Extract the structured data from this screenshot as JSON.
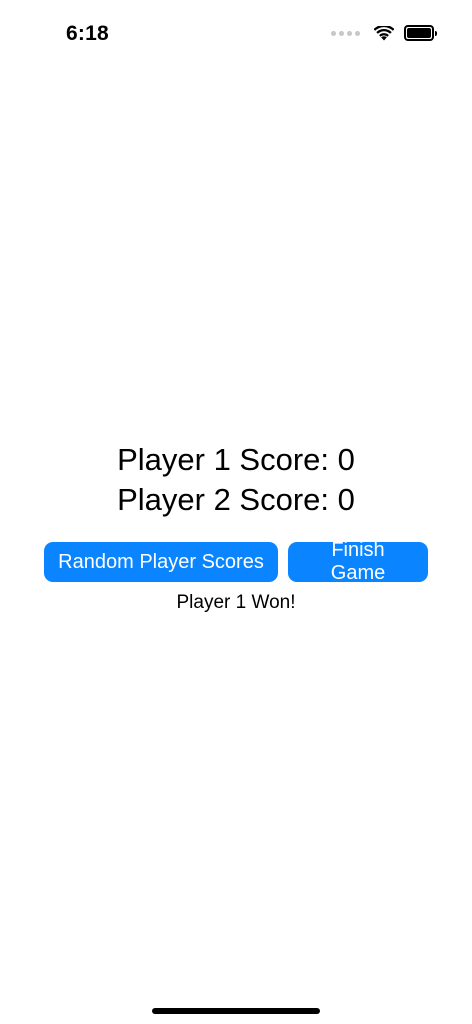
{
  "status_bar": {
    "time": "6:18",
    "icons": [
      "cellular-dots-icon",
      "wifi-icon",
      "battery-icon"
    ]
  },
  "scores": {
    "player1": "Player 1 Score: 0",
    "player2": "Player 2 Score: 0"
  },
  "buttons": {
    "random_label": "Random Player Scores",
    "finish_label": "Finish Game"
  },
  "result_text": "Player 1 Won!",
  "colors": {
    "accent": "#0a84ff",
    "background": "#ffffff",
    "text": "#000000"
  }
}
